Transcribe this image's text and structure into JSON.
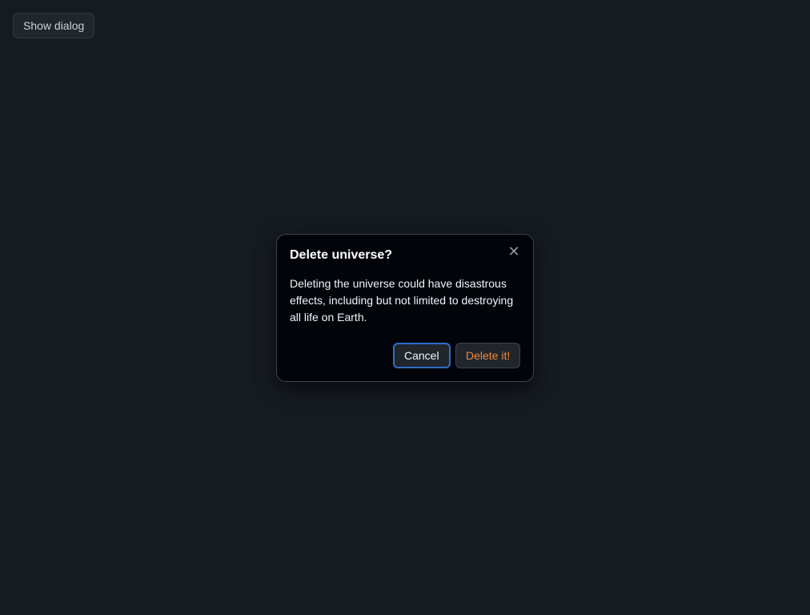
{
  "page": {
    "show_dialog_label": "Show dialog"
  },
  "dialog": {
    "title": "Delete universe?",
    "close_icon": "close-icon",
    "close_symbol": "✕",
    "body": "Deleting the universe could have disastrous effects, including but not limited to destroying all life on Earth.",
    "cancel_label": "Cancel",
    "delete_label": "Delete it!"
  },
  "colors": {
    "background": "#161b22",
    "dialog_background": "#010409",
    "focus_ring": "#316dca",
    "danger_text": "#f0883e"
  }
}
